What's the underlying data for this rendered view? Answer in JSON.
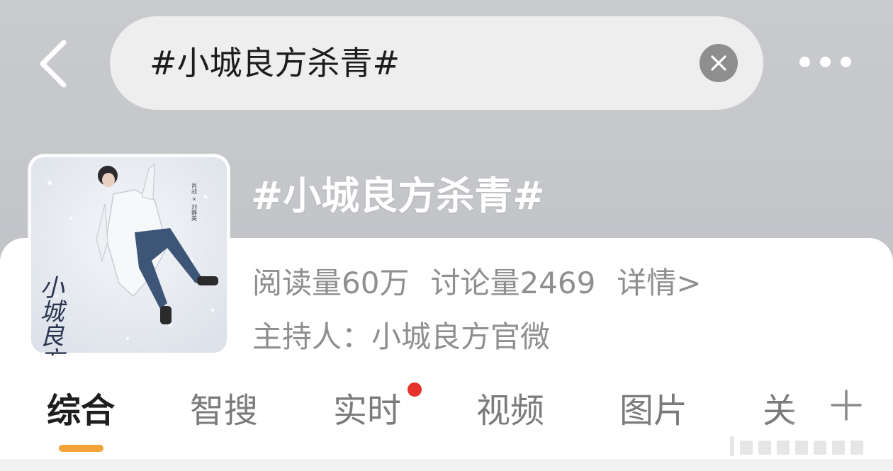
{
  "search": {
    "query": "#小城良方杀青#"
  },
  "topic": {
    "title": "#小城良方杀青#",
    "reads": "阅读量60万",
    "discussions": "讨论量2469",
    "detail_link": "详情>",
    "host": "主持人：小城良方官微"
  },
  "cover": {
    "poster_title": "小城良方",
    "poster_caption": "肖战 × 刘静美"
  },
  "tabs": [
    {
      "label": "综合",
      "active": true
    },
    {
      "label": "智搜",
      "active": false
    },
    {
      "label": "实时",
      "active": false,
      "has_dot": true
    },
    {
      "label": "视频",
      "active": false
    },
    {
      "label": "图片",
      "active": false
    },
    {
      "label": "关",
      "active": false
    }
  ],
  "icons": {
    "back": "back-chevron-icon",
    "clear": "clear-icon",
    "more": "more-dots-icon",
    "add": "plus-icon"
  },
  "colors": {
    "tab_indicator": "#f2a33a",
    "notification_dot": "#e6322d",
    "muted_text": "#8f8f8f"
  }
}
